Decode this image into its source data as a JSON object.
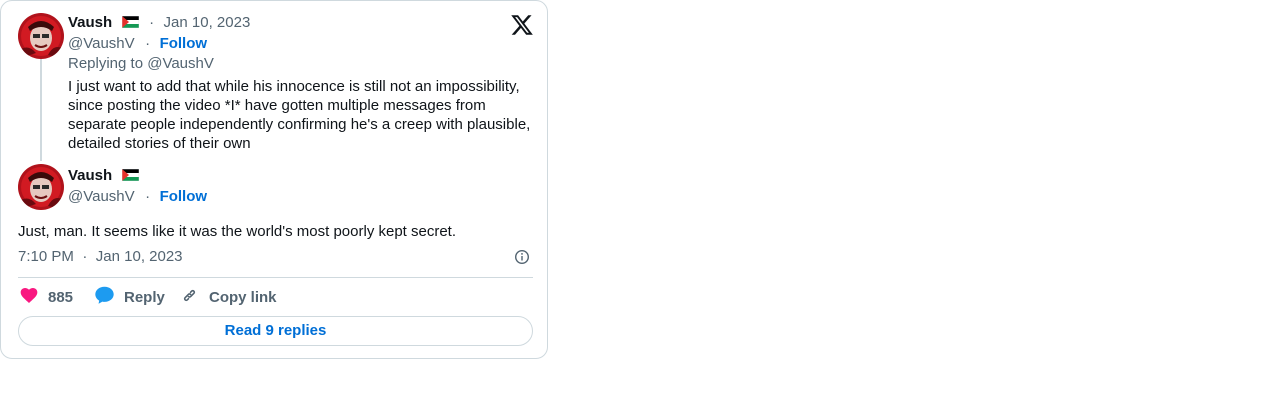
{
  "reply_tweet": {
    "author_name": "Vaush",
    "author_handle": "@VaushV",
    "date": "Jan 10, 2023",
    "separator": "·",
    "follow_label": "Follow",
    "replying_to": "Replying to @VaushV",
    "text": "I just want to add that while his innocence is still not an impossibility, since posting the video *I* have gotten multiple messages from separate people independently confirming he's a creep with plausible, detailed stories of their own"
  },
  "main_tweet": {
    "author_name": "Vaush",
    "author_handle": "@VaushV",
    "separator": "·",
    "follow_label": "Follow",
    "text": "Just, man. It seems like it was the world's most poorly kept secret.",
    "time": "7:10 PM",
    "date": "Jan 10, 2023"
  },
  "actions": {
    "likes_count": "885",
    "reply_label": "Reply",
    "copy_link_label": "Copy link",
    "read_replies_label": "Read 9 replies"
  },
  "icons": {
    "logo": "x-logo-icon",
    "flag": "palestine-flag-icon",
    "info": "info-icon",
    "like": "heart-icon",
    "reply": "speech-bubble-icon",
    "copy": "link-icon"
  },
  "colors": {
    "link_blue": "#006fd6",
    "heart_pink": "#f91880",
    "reply_blue": "#1d9bf0",
    "muted_text": "#536471",
    "border": "#cfd9de"
  }
}
